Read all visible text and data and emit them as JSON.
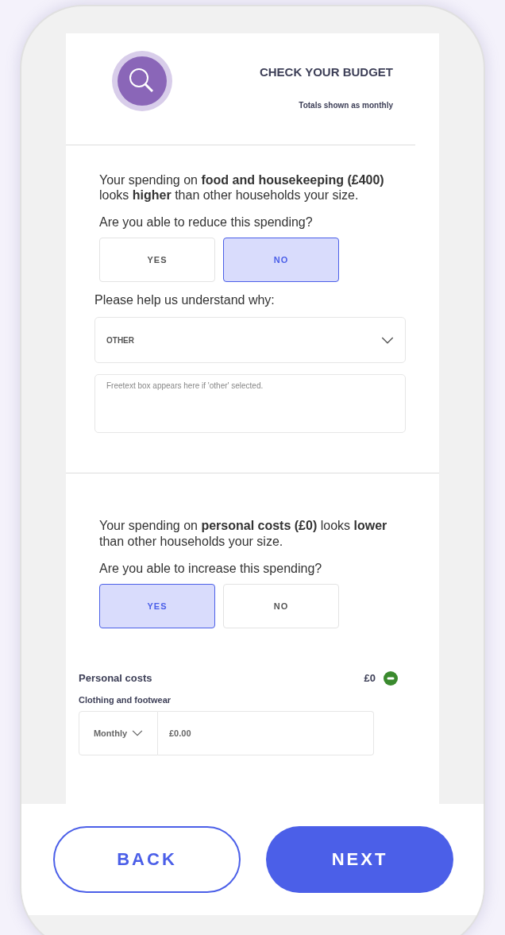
{
  "header": {
    "title": "CHECK YOUR BUDGET",
    "subtitle": "Totals shown as monthly"
  },
  "questions": [
    {
      "statement": "Your spending on **food and housekeeping (£400)** looks **higher** than other households your size.",
      "question": "Are you able to reduce this spending?",
      "options": [
        {
          "label": "YES",
          "selected": false
        },
        {
          "label": "NO",
          "selected": true
        }
      ],
      "reason": {
        "label": "Please help us understand why:",
        "value": "OTHER",
        "placeholder": "Freetext box appears here if 'other' selected."
      }
    },
    {
      "statement": "Your spending on **personal costs (£0)** looks **lower** than other households your size.",
      "question": "Are you able to increase this spending?",
      "options": [
        {
          "label": "YES",
          "selected": true
        },
        {
          "label": "NO",
          "selected": false
        }
      ],
      "category": {
        "name": "Personal costs",
        "total": "£0",
        "item": "Clothing and footwear",
        "frequency": "Monthly",
        "amount": "£0.00"
      }
    }
  ],
  "buttons": [
    {
      "label": "BACK",
      "kind": "secondary"
    },
    {
      "label": "NEXT",
      "kind": "primary"
    }
  ]
}
